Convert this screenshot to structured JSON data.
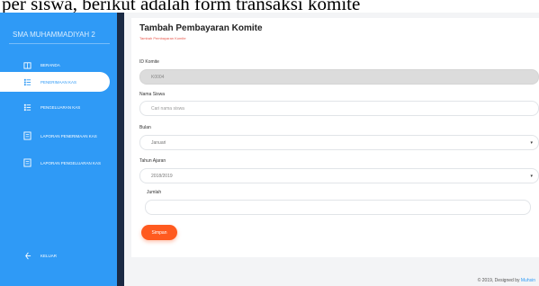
{
  "document": {
    "text_fragment": "per siswa, berikut adalah form transaksi komite"
  },
  "sidebar": {
    "brand": "SMA MUHAMMADIYAH 2",
    "items": [
      {
        "label": "BERANDA",
        "icon": "home-icon",
        "active": false
      },
      {
        "label": "PENERIMAAN KAS",
        "icon": "list-icon",
        "active": true
      },
      {
        "label": "PENGELUARAN KAS",
        "icon": "list-icon",
        "active": false
      },
      {
        "label": "LAPORAN PENERIMAAN KAS",
        "icon": "report-icon",
        "active": false
      },
      {
        "label": "LAPORAN PENGELUARAN KAS",
        "icon": "report-icon",
        "active": false
      },
      {
        "label": "KELUAR",
        "icon": "logout-icon",
        "active": false
      }
    ]
  },
  "page": {
    "title": "Tambah Pembayaran Komite",
    "subtitle": "Tambah Pembayaran Komite"
  },
  "form": {
    "id_komite": {
      "label": "ID Komite",
      "value": "K0004"
    },
    "nama_siswa": {
      "label": "Nama Siswa",
      "placeholder": "Cari nama siswa"
    },
    "bulan": {
      "label": "Bulan",
      "value": "Januari"
    },
    "tahun_ajaran": {
      "label": "Tahun Ajaran",
      "value": "2018/2019"
    },
    "jumlah": {
      "label": "Jumlah",
      "value": ""
    },
    "submit_label": "Simpan"
  },
  "footer": {
    "prefix": "© 2019, Designed by",
    "author": "Muhsin"
  },
  "colors": {
    "sidebar": "#2f9af6",
    "accent_button": "#ff5a1f",
    "subtitle": "#e85a4f"
  }
}
